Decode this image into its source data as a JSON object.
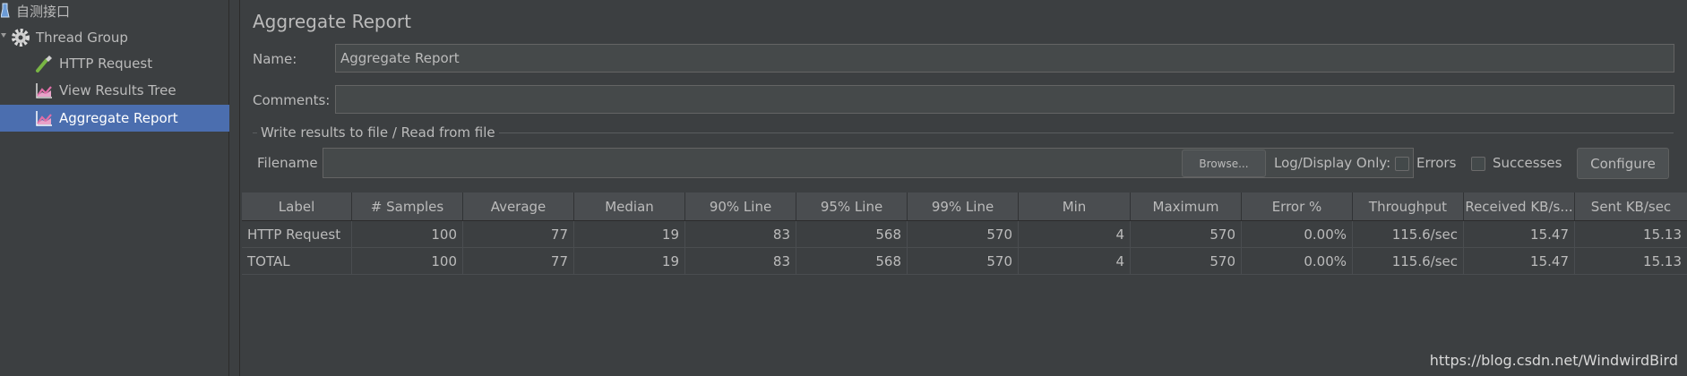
{
  "tree": {
    "items": [
      {
        "label": "自测接口",
        "icon": "flask-icon"
      },
      {
        "label": "Thread Group",
        "icon": "gear-icon"
      },
      {
        "label": "HTTP Request",
        "icon": "pipette-icon"
      },
      {
        "label": "View Results Tree",
        "icon": "listener-chart-icon"
      },
      {
        "label": "Aggregate Report",
        "icon": "listener-chart-icon",
        "selected": true
      }
    ]
  },
  "panel": {
    "title": "Aggregate Report",
    "name_label": "Name:",
    "name_value": "Aggregate Report",
    "comments_label": "Comments:",
    "comments_value": "",
    "group_title": "Write results to file / Read from file",
    "filename_label": "Filename",
    "filename_value": "",
    "browse_label": "Browse...",
    "log_display_label": "Log/Display Only:",
    "errors_label": "Errors",
    "successes_label": "Successes",
    "configure_label": "Configure"
  },
  "table": {
    "columns": [
      "Label",
      "# Samples",
      "Average",
      "Median",
      "90% Line",
      "95% Line",
      "99% Line",
      "Min",
      "Maximum",
      "Error %",
      "Throughput",
      "Received KB/s...",
      "Sent KB/sec"
    ],
    "rows": [
      [
        "HTTP Request",
        "100",
        "77",
        "19",
        "83",
        "568",
        "570",
        "4",
        "570",
        "0.00%",
        "115.6/sec",
        "15.47",
        "15.13"
      ],
      [
        "TOTAL",
        "100",
        "77",
        "19",
        "83",
        "568",
        "570",
        "4",
        "570",
        "0.00%",
        "115.6/sec",
        "15.47",
        "15.13"
      ]
    ]
  },
  "watermark": "https://blog.csdn.net/WindwirdBird",
  "colors": {
    "background": "#3c3f41",
    "selection": "#4b6eaf",
    "text": "#bbbbbb"
  }
}
